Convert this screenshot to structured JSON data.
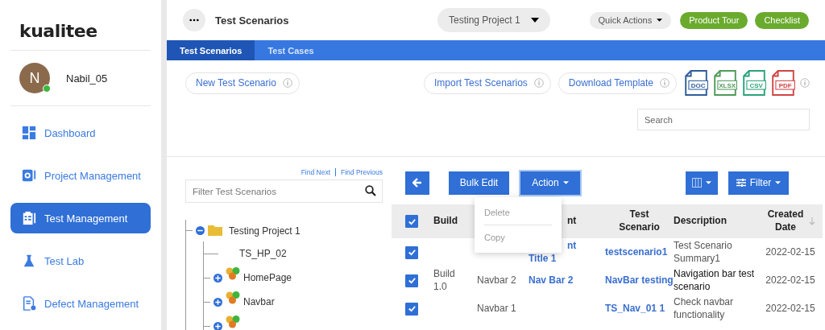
{
  "logo": {
    "text": "kualitee"
  },
  "user": {
    "initial": "N",
    "name": "Nabil_05",
    "online": true
  },
  "nav": [
    {
      "label": "Dashboard",
      "kind": "dashboard",
      "selected": false
    },
    {
      "label": "Project Management",
      "kind": "project",
      "selected": false
    },
    {
      "label": "Test Management",
      "kind": "test",
      "selected": true
    },
    {
      "label": "Test Lab",
      "kind": "lab",
      "selected": false
    },
    {
      "label": "Defect Management",
      "kind": "defect",
      "selected": false
    }
  ],
  "header": {
    "title": "Test Scenarios",
    "project": "Testing Project 1",
    "buttons": [
      {
        "label": "Quick Actions",
        "kind": "dropdown"
      },
      {
        "label": "Product Tour",
        "kind": "green"
      },
      {
        "label": "Checklist",
        "kind": "green"
      }
    ]
  },
  "tabs": [
    {
      "label": "Test Scenarios",
      "selected": true
    },
    {
      "label": "Test Cases",
      "selected": false
    }
  ],
  "toolbar": {
    "actions": [
      "New Test Scenario",
      "Import Test Scenarios",
      "Download Template"
    ],
    "file_types": [
      {
        "label": "DOC",
        "color": "#2f5d9a"
      },
      {
        "label": "XLSX",
        "color": "#4f9a5a"
      },
      {
        "label": "CSV",
        "color": "#2ba37a"
      },
      {
        "label": "PDF",
        "color": "#d04545"
      }
    ],
    "search": {
      "placeholder": "Search"
    }
  },
  "tree": {
    "find_links": [
      "Find Next",
      "Find Previous"
    ],
    "filter": {
      "placeholder": "Filter Test Scenarios"
    },
    "nodes": [
      {
        "label": "Testing Project 1",
        "kind": "folder",
        "expanded": true,
        "children": [
          {
            "label": "TS_HP_02",
            "kind": "leaf"
          },
          {
            "label": "HomePage",
            "kind": "module",
            "expanded": false
          },
          {
            "label": "Navbar",
            "kind": "module",
            "expanded": false
          },
          {
            "kind": "module",
            "expanded": false
          }
        ]
      }
    ]
  },
  "table": {
    "buttons": [
      "Bulk Edit",
      "Action"
    ],
    "filter_button": "Filter",
    "all_checked": true,
    "columns": {
      "build": "Build",
      "column_3": "nt",
      "test_scenario": "Test Scenario",
      "description": "Description",
      "created_date": "Created Date"
    },
    "rows": [
      {
        "checked": true,
        "hover": false,
        "column_3": [
          "nt",
          "Title 1"
        ],
        "test_scenario": "testscenario1",
        "description": "Test Scenario Summary1",
        "created_date": "2022-02-15"
      },
      {
        "checked": true,
        "hover": true,
        "build": "Build 1.0",
        "column_2": "Navbar 2",
        "column_3": [
          "Nav Bar 2"
        ],
        "test_scenario": "NavBar testing",
        "description": "Navigation bar test scenario",
        "created_date": "2022-02-15"
      },
      {
        "checked": true,
        "hover": false,
        "column_2": "Navbar 1",
        "test_scenario": "TS_Nav_01 1",
        "description": "Check navbar functionality",
        "created_date": "2022-02-15"
      }
    ]
  },
  "action_menu": {
    "items": [
      {
        "label": "Delete",
        "disabled": true
      },
      {
        "label": "Copy",
        "disabled": true
      }
    ]
  }
}
